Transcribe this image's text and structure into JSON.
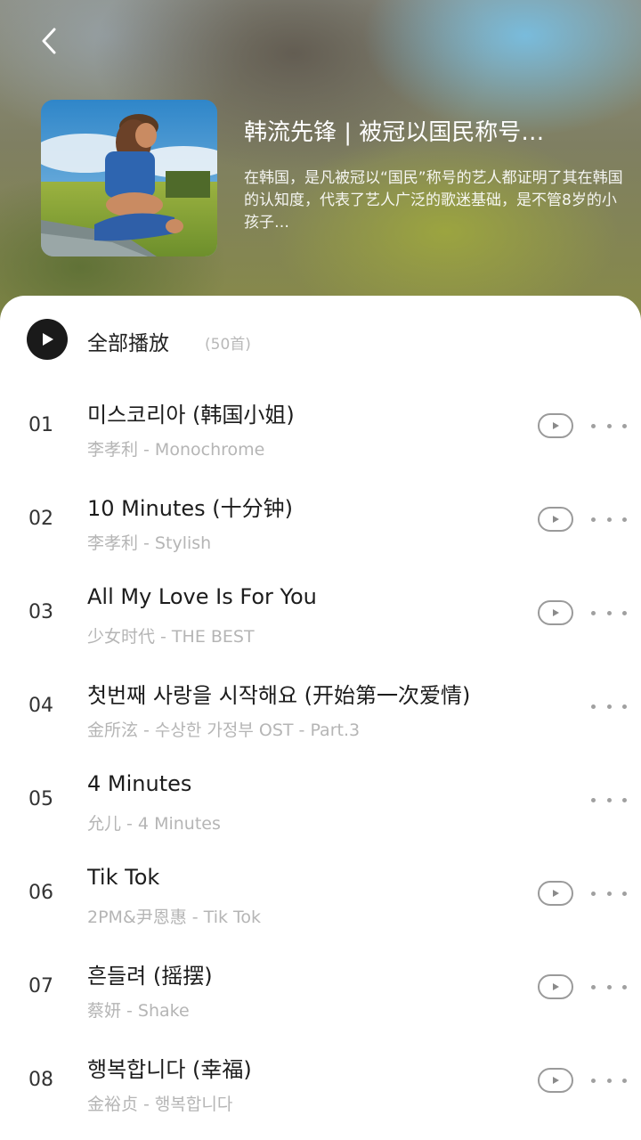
{
  "header": {
    "back_icon": "chevron-left-icon",
    "title": "韩流先锋 | 被冠以国民称号…",
    "description": "在韩国，是凡被冠以“国民”称号的艺人都证明了其在韩国的认知度，代表了艺人广泛的歌迷基础，是不管8岁的小孩子…"
  },
  "play_all": {
    "icon": "play-icon",
    "label": "全部播放",
    "count": "(50首)"
  },
  "tracks": [
    {
      "num": "01",
      "title": "미스코리아 (韩国小姐)",
      "subtitle": "李孝利 - Monochrome",
      "has_mv": true
    },
    {
      "num": "02",
      "title": "10 Minutes (十分钟)",
      "subtitle": "李孝利 - Stylish",
      "has_mv": true
    },
    {
      "num": "03",
      "title": "All My Love Is For You",
      "subtitle": "少女时代 - THE BEST",
      "has_mv": true
    },
    {
      "num": "04",
      "title": "첫번째 사랑을 시작해요 (开始第一次爱情)",
      "subtitle": "金所泫 - 수상한 가정부 OST - Part.3",
      "has_mv": false
    },
    {
      "num": "05",
      "title": "4 Minutes",
      "subtitle": "允儿 - 4 Minutes",
      "has_mv": false
    },
    {
      "num": "06",
      "title": "Tik Tok",
      "subtitle": "2PM&尹恩惠 - Tik Tok",
      "has_mv": true
    },
    {
      "num": "07",
      "title": "흔들려 (摇摆)",
      "subtitle": "蔡妍 - Shake",
      "has_mv": true
    },
    {
      "num": "08",
      "title": "행복합니다 (幸福)",
      "subtitle": "金裕贞 - 행복합니다",
      "has_mv": true
    }
  ],
  "colors": {
    "primary_text": "#1c1c1c",
    "secondary_text": "#b5b5b5",
    "play_all_icon_bg": "#1a1a1a"
  }
}
